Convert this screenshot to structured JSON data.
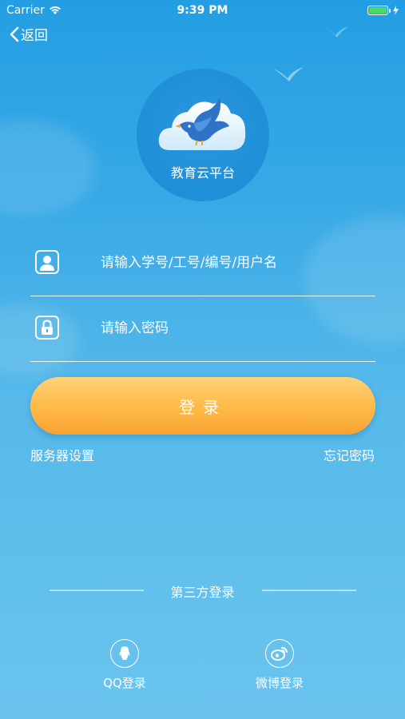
{
  "status_bar": {
    "carrier": "Carrier",
    "time": "9:39 PM",
    "battery_level": 1.0
  },
  "nav": {
    "back_label": "返回"
  },
  "logo": {
    "title": "教育云平台"
  },
  "form": {
    "username_placeholder": "请输入学号/工号/编号/用户名",
    "password_placeholder": "请输入密码",
    "login_label": "登录",
    "server_settings": "服务器设置",
    "forgot_password": "忘记密码"
  },
  "third_party": {
    "title": "第三方登录",
    "items": [
      {
        "label": "QQ登录",
        "icon": "qq-icon"
      },
      {
        "label": "微博登录",
        "icon": "weibo-icon"
      }
    ]
  },
  "colors": {
    "background_top": "#239ee3",
    "background_bottom": "#6ac4ee",
    "button_top": "#ffd177",
    "button_bottom": "#f7a233",
    "battery_fill": "#4cd964"
  }
}
